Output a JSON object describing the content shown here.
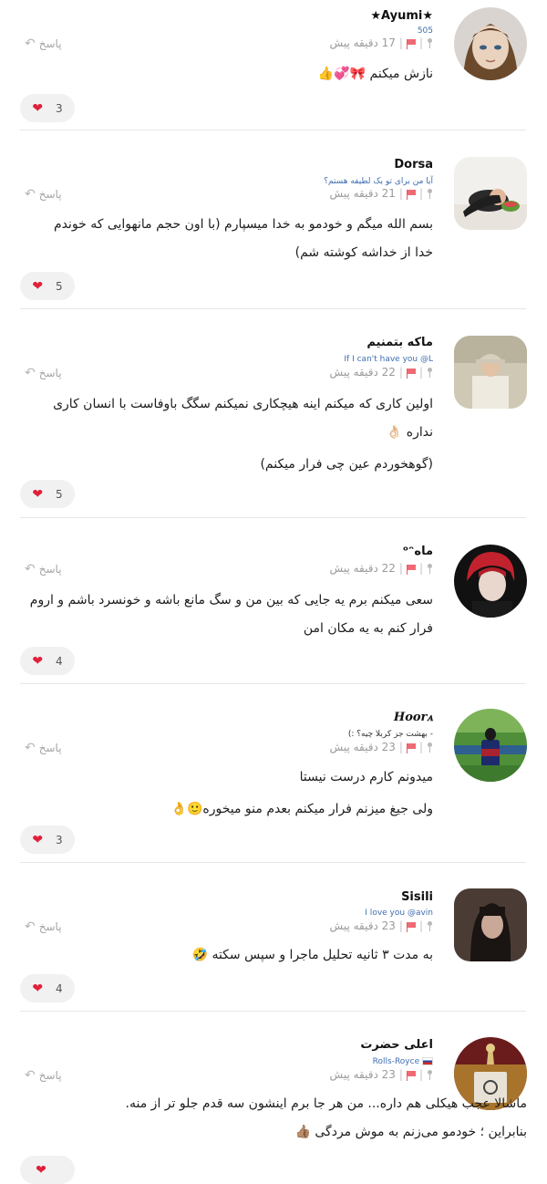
{
  "common": {
    "reply_label": "پاسخ",
    "reply_icon": "↶",
    "heart_icon": "❤",
    "heart_color": "#e0203a",
    "link_color": "#3f6fb0"
  },
  "comments": [
    {
      "username": "★Ayumi★",
      "bio": "505",
      "time": "17 دقیقه پیش",
      "lines": [
        "نازش میکنم 🎀💞👍"
      ],
      "likes": "3"
    },
    {
      "username": "Dorsa",
      "bio": "آیا من برای تو یک لطیفه هستم؟",
      "time": "21 دقیقه پیش",
      "lines": [
        "بسم الله میگم و خودمو به خدا میسپارم (با اون حجم مانهوایی که خوندم",
        "خدا از خداشه کوشته شم)"
      ],
      "likes": "5"
    },
    {
      "username": "ماکه بتمنیم",
      "bio": "If I can't have you @L",
      "time": "22 دقیقه پیش",
      "lines": [
        "اولین کاری که میکنم اینه هیچکاری نمیکنم سگگ باوفاست با انسان کاری",
        "نداره 👌🏻",
        "(گوهخوردم عین چی فرار میکنم)"
      ],
      "likes": "5"
    },
    {
      "username": "ماه‌ᵒᵔ",
      "bio": "",
      "time": "22 دقیقه پیش",
      "lines": [
        "سعی میکنم برم یه جایی که بین من و سگ مانع باشه و خونسرد باشم و اروم",
        "فرار کنم به یه مکان امن"
      ],
      "likes": "4"
    },
    {
      "username": "Hoorꭺ",
      "bio": "- بهشت جز کربلا چیه؟ :)",
      "time": "23 دقیقه پیش",
      "lines": [
        "میدونم کارم درست نیستا",
        "ولی جیغ میزنم فرار میکنم بعدم منو میخوره🙂👌"
      ],
      "likes": "3"
    },
    {
      "username": "Sisili",
      "bio": "I love you @avin",
      "time": "23 دقیقه پیش",
      "lines": [
        "به مدت ۳ ثانیه تحلیل ماجرا و سپس سکته 🤣"
      ],
      "likes": "4"
    },
    {
      "username": "اعلی حضرت",
      "bio": "Rolls-Royce",
      "time": "23 دقیقه پیش",
      "lines": [
        "ماشالا عجب هیکلی هم داره... من هر جا برم اینشون سه قدم جلو تر از منه.",
        "بنابراین ؛ خودمو می‌زنم به موش مردگی 👍🏽"
      ],
      "likes": ""
    }
  ]
}
